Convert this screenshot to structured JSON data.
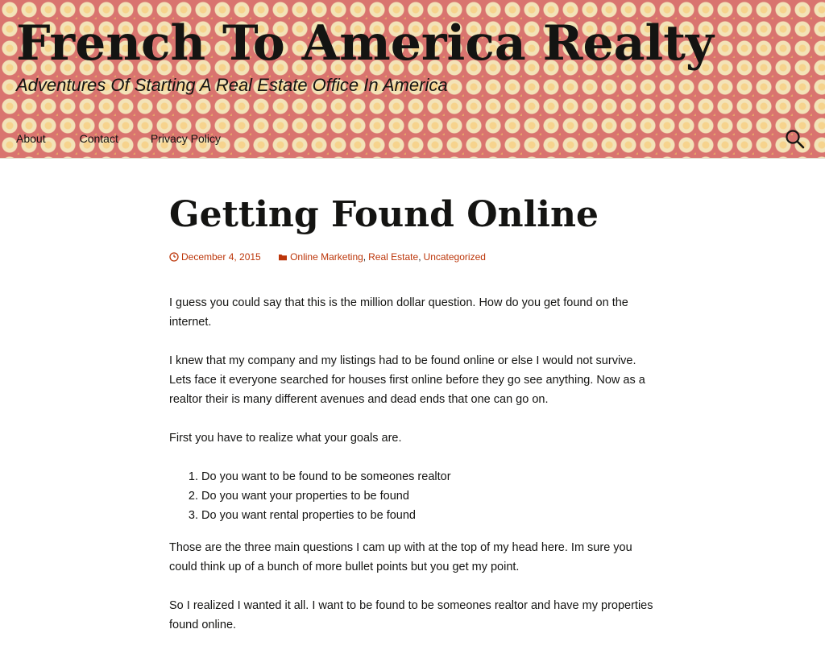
{
  "site": {
    "title": "French To America Realty",
    "description": "Adventures Of Starting A Real Estate Office In America"
  },
  "nav": {
    "items": [
      {
        "label": "About"
      },
      {
        "label": "Contact"
      },
      {
        "label": "Privacy Policy"
      }
    ],
    "search_icon": "search-icon"
  },
  "post": {
    "title": "Getting Found Online",
    "date": "December 4, 2015",
    "date_icon": "clock-icon",
    "categories_icon": "folder-icon",
    "categories": [
      "Online Marketing",
      "Real Estate",
      "Uncategorized"
    ],
    "paragraphs": [
      "I guess you could say that this is the million dollar question.  How do you get found on the internet.",
      "I knew that my company and my listings had to be found online or else I would not survive.  Lets face it everyone searched for houses first online before they go see anything.  Now as a realtor their is many different avenues and dead ends that one can go on.",
      "First you have to realize what your goals are."
    ],
    "goals": [
      "Do you want to be found to be someones realtor",
      "Do you want your properties to be found",
      "Do you want rental properties to be found"
    ],
    "paragraphs_after": [
      "Those are the three main questions I cam up with at the top of my head here.  Im sure you could think up of a bunch of more bullet points but you get my point.",
      "So I realized I wanted it all.  I want to be found to be someones realtor and have my properties found online."
    ]
  },
  "colors": {
    "link": "#bc360a",
    "text": "#141412",
    "header_bg": "#d9746f"
  }
}
